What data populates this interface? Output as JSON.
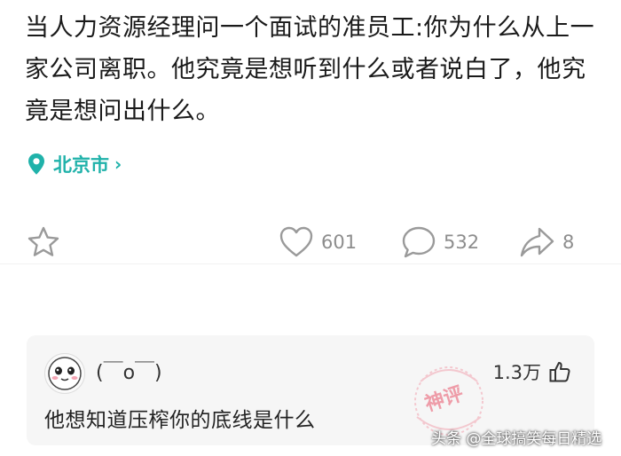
{
  "post": {
    "text": "当人力资源经理问一个面试的准员工:你为什么从上一家公司离职。他究竟是想听到什么或者说白了，他究竟是想问出什么。",
    "location": "北京市"
  },
  "actions": {
    "like_count": "601",
    "comment_count": "532",
    "share_count": "8"
  },
  "comment": {
    "username": "(￣o￣)",
    "likes": "1.3万",
    "text": "他想知道压榨你的底线是什么",
    "badge": "神评"
  },
  "watermark": "头条 @全球搞笑每日精选",
  "colors": {
    "accent": "#20b2aa",
    "icon_gray": "#9a9a9a",
    "badge": "#e8546a"
  }
}
